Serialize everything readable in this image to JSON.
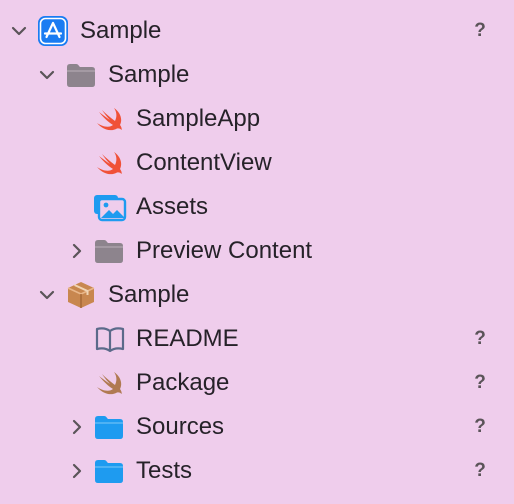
{
  "navigator": {
    "items": [
      {
        "label": "Sample",
        "status": "?",
        "icon": "app-store-project-icon"
      },
      {
        "label": "Sample",
        "status": "",
        "icon": "folder-icon"
      },
      {
        "label": "SampleApp",
        "status": "",
        "icon": "swift-icon"
      },
      {
        "label": "ContentView",
        "status": "",
        "icon": "swift-icon"
      },
      {
        "label": "Assets",
        "status": "",
        "icon": "asset-catalog-icon"
      },
      {
        "label": "Preview Content",
        "status": "",
        "icon": "folder-icon"
      },
      {
        "label": "Sample",
        "status": "",
        "icon": "package-icon"
      },
      {
        "label": "README",
        "status": "?",
        "icon": "book-icon"
      },
      {
        "label": "Package",
        "status": "?",
        "icon": "swift-package-icon"
      },
      {
        "label": "Sources",
        "status": "?",
        "icon": "blue-folder-icon"
      },
      {
        "label": "Tests",
        "status": "?",
        "icon": "blue-folder-icon"
      }
    ]
  },
  "colors": {
    "background": "#efcdec",
    "swift": "#f05138",
    "folder_gray": "#8d848d",
    "folder_blue": "#1e9bf0",
    "package_brown": "#c8874f",
    "text": "#262229",
    "status": "#5b5459"
  }
}
